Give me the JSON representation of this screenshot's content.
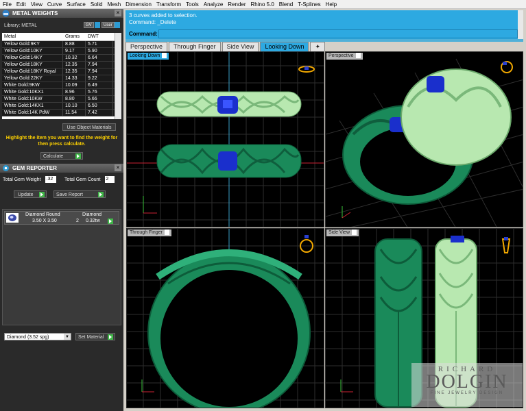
{
  "menu": [
    "File",
    "Edit",
    "View",
    "Curve",
    "Surface",
    "Solid",
    "Mesh",
    "Dimension",
    "Transform",
    "Tools",
    "Analyze",
    "Render",
    "Rhino 5.0",
    "Blend",
    "T-Splines",
    "Help"
  ],
  "metal_panel": {
    "title": "METAL WEIGHTS",
    "library": "Library: METAL",
    "gv": "GV",
    "user": "User",
    "columns": [
      "Metal",
      "Grams",
      "DWT"
    ],
    "rows": [
      [
        "Yellow Gold:9KY",
        "8.88",
        "5.71"
      ],
      [
        "Yellow Gold:10KY",
        "9.17",
        "5.90"
      ],
      [
        "Yellow Gold:14KY",
        "10.32",
        "6.64"
      ],
      [
        "Yellow Gold:18KY",
        "12.35",
        "7.94"
      ],
      [
        "Yellow Gold:18KY Royal",
        "12.35",
        "7.94"
      ],
      [
        "Yellow Gold:22KY",
        "14.33",
        "9.22"
      ],
      [
        "White Gold:9KW",
        "10.09",
        "6.49"
      ],
      [
        "White Gold:10KX1",
        "8.96",
        "5.76"
      ],
      [
        "White Gold:10KW",
        "8.80",
        "5.66"
      ],
      [
        "White Gold:14KX1",
        "10.10",
        "6.50"
      ],
      [
        "White Gold:14K PdW",
        "11.54",
        "7.42"
      ]
    ],
    "use_object_materials": "Use Object Materials",
    "hint": "Highlight the item you want to find the weight for then press calculate.",
    "calculate": "Calculate"
  },
  "gem_panel": {
    "title": "GEM REPORTER",
    "total_weight_label": "Total Gem Weight",
    "total_weight_value": ".32",
    "total_count_label": "Total Gem Count",
    "total_count_value": "2",
    "update": "Update",
    "save_report": "Save Report",
    "gem_row": {
      "shape": "Diamond Round",
      "size": "3.50 X 3.50",
      "count": "2",
      "material": "Diamond",
      "weight": "0.32tw"
    },
    "material_select": "Diamond    (3.52 spg)",
    "set_material": "Set Material"
  },
  "command": {
    "history_1": "3 curves added to selection.",
    "history_2": "Command: _Delete",
    "prompt": "Command:"
  },
  "tabs": [
    {
      "label": "Perspective",
      "active": false
    },
    {
      "label": "Through Finger",
      "active": false
    },
    {
      "label": "Side View",
      "active": false
    },
    {
      "label": "Looking Down",
      "active": true
    },
    {
      "label": "✦",
      "active": false
    }
  ],
  "viewports": {
    "top_left": "Looking Down",
    "top_right": "Perspective",
    "bottom_left": "Through Finger",
    "bottom_right": "Side View"
  },
  "watermark": {
    "line1": "RICHARD",
    "line2": "DOLGIN",
    "line3": "FINE JEWELRY DESIGN"
  },
  "colors": {
    "light_green": "#b8e8b0",
    "dark_green": "#1a8a5a",
    "sapphire": "#1a2fcc",
    "grid": "#3a3a3a",
    "accent": "#2da9e1"
  }
}
